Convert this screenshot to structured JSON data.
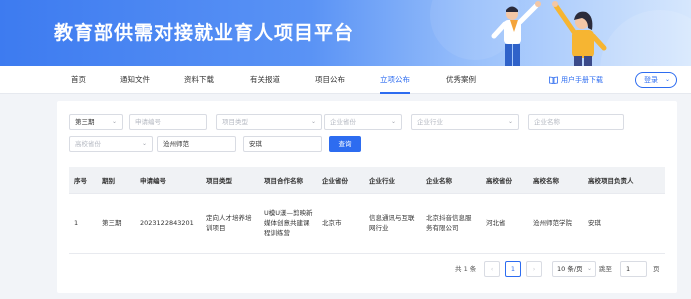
{
  "header": {
    "title": "教育部供需对接就业育人项目平台"
  },
  "nav": {
    "items": [
      {
        "label": "首页"
      },
      {
        "label": "通知文件"
      },
      {
        "label": "资料下载"
      },
      {
        "label": "有关报道"
      },
      {
        "label": "项目公布"
      },
      {
        "label": "立项公布"
      },
      {
        "label": "优秀案例"
      }
    ],
    "active": "立项公布",
    "manual_label": "用户手册下载",
    "login_label": "登录"
  },
  "filters": {
    "period_value": "第三期",
    "application_no_placeholder": "申请编号",
    "project_type_placeholder": "项目类型",
    "company_province_placeholder": "企业省份",
    "company_industry_placeholder": "企业行业",
    "company_name_placeholder": "企业名称",
    "school_province_placeholder": "高校省份",
    "school_name_value": "沧州师范",
    "leader_value": "安琪",
    "query_label": "查询"
  },
  "table": {
    "headers": [
      "序号",
      "期别",
      "申请编号",
      "项目类型",
      "项目合作名称",
      "企业省份",
      "企业行业",
      "企业名称",
      "高校省份",
      "高校名称",
      "高校项目负责人"
    ],
    "rows": [
      [
        "1",
        "第三期",
        "2023122843201",
        "定向人才培养培训项目",
        "U模U漾—剪映新媒体创意共建课程训练营",
        "北京市",
        "信息通讯与互联网行业",
        "北京抖音信息服务有限公司",
        "河北省",
        "沧州师范学院",
        "安琪"
      ]
    ]
  },
  "pagination": {
    "total_label": "共 1 条",
    "prev": "‹",
    "current_page": "1",
    "next": "›",
    "page_size": "10 条/页",
    "jump_label": "跳至",
    "jump_value": "1",
    "page_unit": "页"
  },
  "colors": {
    "accent": "#2d6cf0",
    "banner_start": "#3d7bf0",
    "banner_end": "#d6e7fd"
  }
}
